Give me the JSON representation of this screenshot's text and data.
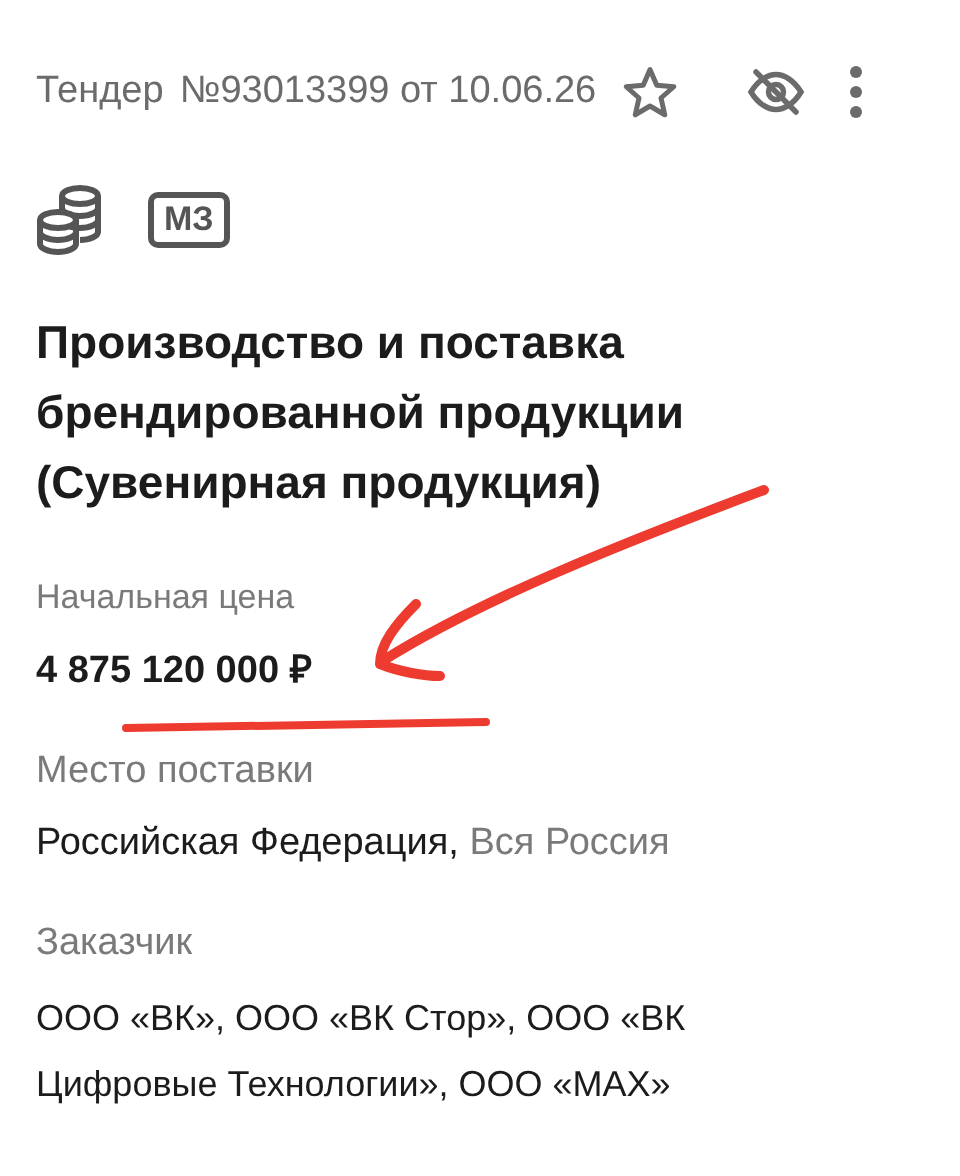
{
  "header": {
    "type": "Тендер",
    "number": "№93013399 от 10.06.26",
    "starred": false,
    "hidden": true
  },
  "badge": "МЗ",
  "title": "Производство и поставка брендированной продукции (Сувенирная продукция)",
  "price": {
    "label": "Начальная цена",
    "value": "4 875 120 000 ₽"
  },
  "delivery": {
    "label": "Место поставки",
    "country": "Российская Федерация,",
    "region": "Вся Россия"
  },
  "customer": {
    "label": "Заказчик",
    "value": "ООО «ВК», ООО «ВК Стор», ООО «ВК Цифровые Технологии», ООО «MAX»"
  }
}
